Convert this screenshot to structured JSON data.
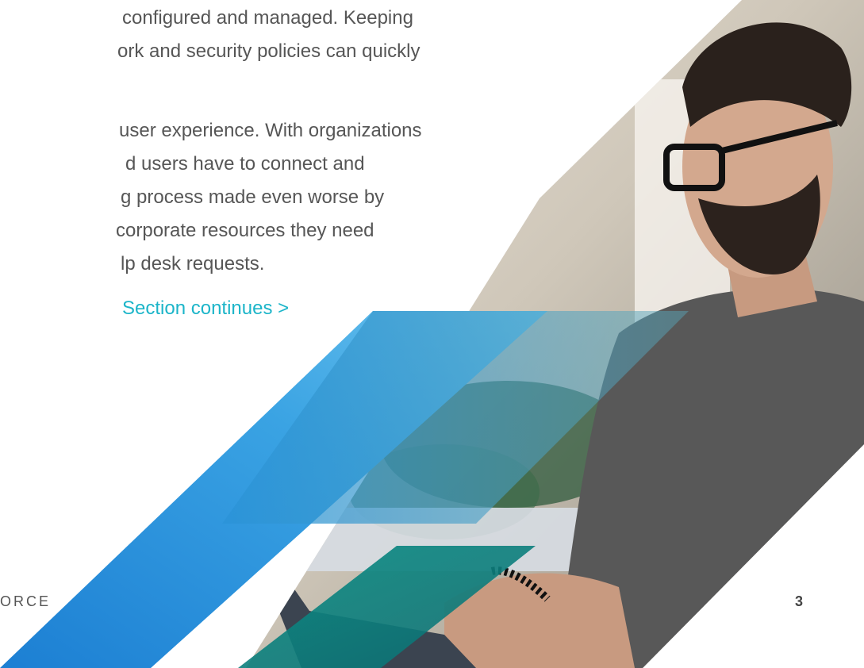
{
  "body_text": {
    "lines": [
      "configured and managed. Keeping",
      "ork and security policies can quickly",
      "user experience. With organizations",
      "d users have to connect and",
      "g process made even worse by",
      "corporate resources they need",
      "lp desk requests."
    ]
  },
  "navigation": {
    "section_link": "Section continues >"
  },
  "footer": {
    "label": "ORCE",
    "page_number": "3"
  },
  "colors": {
    "body_text": "#565656",
    "link": "#1cb5c9",
    "accent_blue": "#1f86d6",
    "accent_teal": "#0e8f85"
  }
}
